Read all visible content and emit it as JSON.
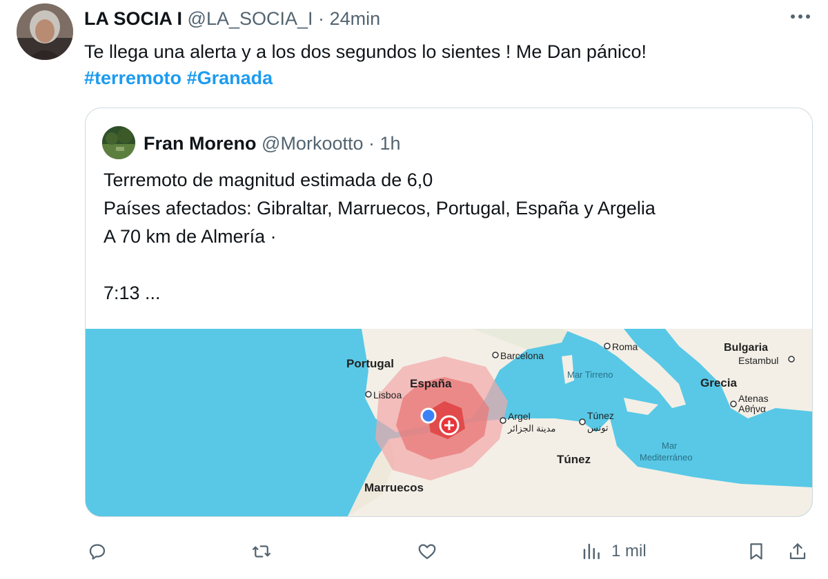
{
  "tweet": {
    "display_name": "LA SOCIA I",
    "handle": "@LA_SOCIA_I",
    "separator": "·",
    "time": "24min",
    "text": "Te llega una alerta y a los dos segundos lo sientes ! Me Dan pánico!",
    "hashtags": [
      "#terremoto",
      "#Granada"
    ],
    "avatar_icon": "person-photo-icon",
    "more_icon": "more-options-icon"
  },
  "quote": {
    "display_name": "Fran Moreno",
    "handle": "@Morkootto",
    "separator": "·",
    "time": "1h",
    "lines": [
      "Terremoto de magnitud estimada de 6,0",
      "Países afectados: Gibraltar, Marruecos, Portugal, España y Argelia",
      "A 70 km de Almería ·",
      "",
      "7:13 ..."
    ],
    "map": {
      "labels": {
        "portugal": "Portugal",
        "espana": "España",
        "lisboa": "Lisboa",
        "barcelona": "Barcelona",
        "roma": "Roma",
        "bulgaria": "Bulgaria",
        "estambul": "Estambul",
        "grecia": "Grecia",
        "atenas": "Atenas",
        "atenas_greek": "Αθήνα",
        "mar_tirreno": "Mar Tirreno",
        "argel": "Argel",
        "argel_arabic": "مدينة الجزائر",
        "tunez_city": "Túnez",
        "tunez_city_arabic": "تونس",
        "tunez_country": "Túnez",
        "mar_med_1": "Mar",
        "mar_med_2": "Mediterráneo",
        "marruecos": "Marruecos"
      },
      "colors": {
        "sea": "#58c8e6",
        "land": "#f3efe6",
        "quake_outer": "#f2a8a8",
        "quake_mid": "#e87878",
        "quake_core": "#e04545",
        "user_dot": "#3b82f6"
      }
    }
  },
  "actions": {
    "reply_icon": "reply-icon",
    "retweet_icon": "retweet-icon",
    "like_icon": "heart-icon",
    "views_icon": "views-chart-icon",
    "views_count": "1 mil",
    "bookmark_icon": "bookmark-icon",
    "share_icon": "share-icon"
  }
}
